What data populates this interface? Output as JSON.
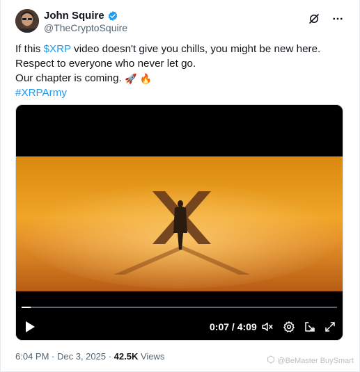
{
  "author": {
    "display_name": "John Squire",
    "handle": "@TheCryptoSquire",
    "avatar_icon": "profile-photo",
    "verified_icon": "verified-badge-icon"
  },
  "top_actions": {
    "grok_icon": "grok-icon",
    "more_icon": "more-icon"
  },
  "tweet": {
    "line1_prefix": "If this ",
    "line1_cashtag": "$XRP",
    "line1_suffix": " video doesn't give you chills, you might be new here.",
    "line2": "Respect to everyone who never let go.",
    "line3": "Our chapter is coming. ",
    "line3_emoji_1": "🚀",
    "line3_emoji_2": "🔥",
    "hashtag": "#XRPArmy"
  },
  "video": {
    "current_time": "0:07",
    "separator": " / ",
    "duration": "4:09",
    "progress": 0.028,
    "icons": [
      "play-icon",
      "mute-icon",
      "settings-icon",
      "pop-out-icon",
      "fullscreen-icon"
    ]
  },
  "meta": {
    "time": "6:04 PM",
    "dot1": " · ",
    "date": "Dec 3, 2025",
    "dot2": " · ",
    "views_count": "42.5K",
    "views_label": " Views"
  },
  "watermark": {
    "text": "@BeMaster BuySmart"
  }
}
